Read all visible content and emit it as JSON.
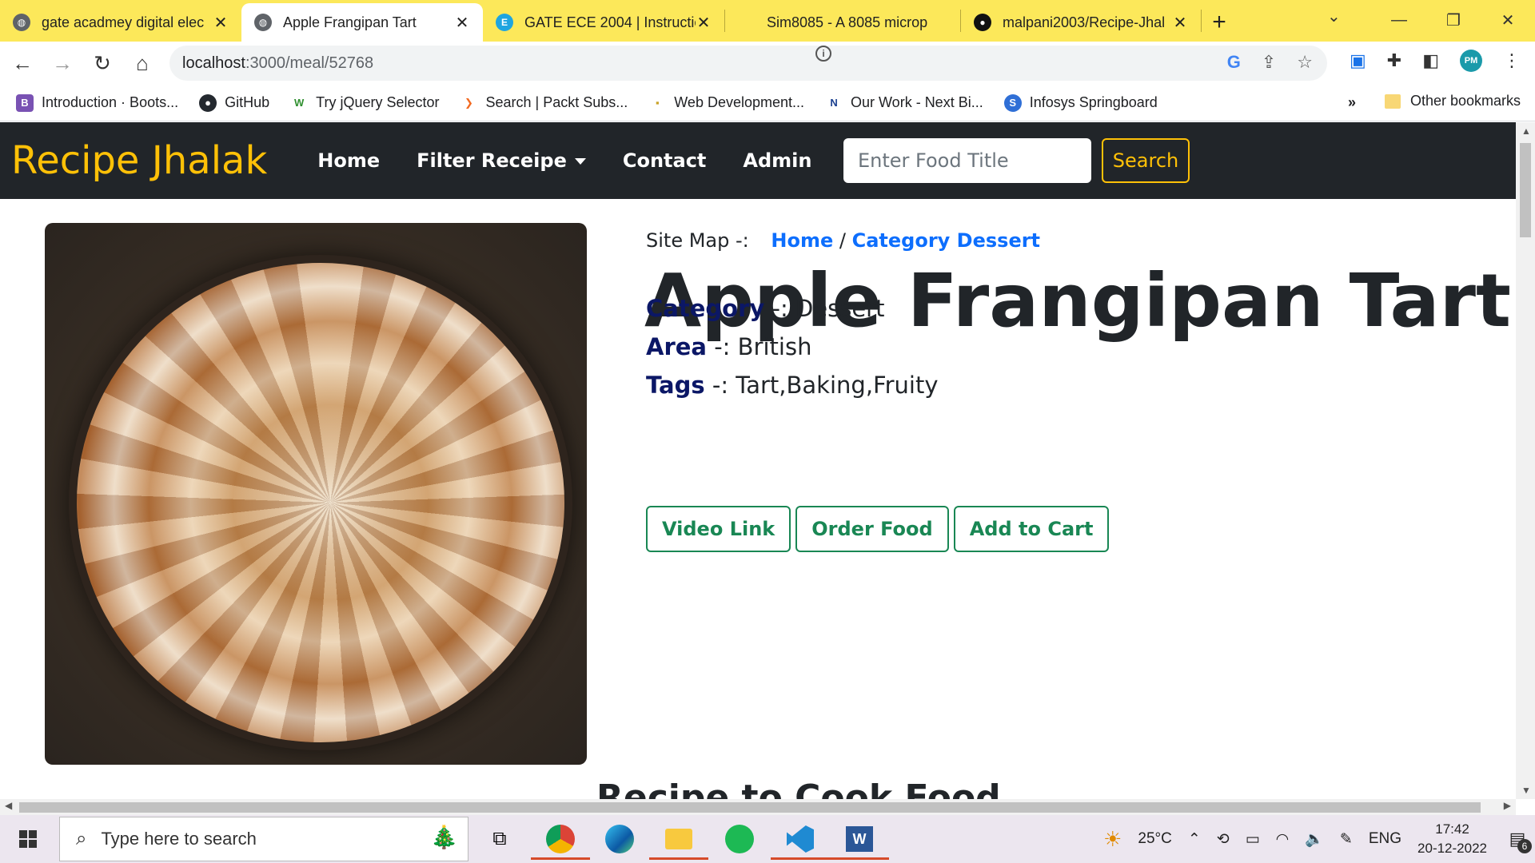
{
  "browser": {
    "tabs": [
      {
        "title": "gate acadmey digital elec",
        "active": false,
        "favicon": "globe-icon"
      },
      {
        "title": "Apple Frangipan Tart",
        "active": true,
        "favicon": "globe-icon"
      },
      {
        "title": "GATE ECE 2004 | Instructio",
        "active": false,
        "favicon": "e-icon"
      },
      {
        "title": "Sim8085 - A 8085 microp",
        "active": false,
        "favicon": "blank"
      },
      {
        "title": "malpani2003/Recipe-Jhal",
        "active": false,
        "favicon": "github-icon"
      }
    ],
    "address": {
      "host": "localhost",
      "path": ":3000/meal/52768"
    },
    "bookmarks": [
      {
        "label": "Introduction · Boots...",
        "icon": "bootstrap-icon",
        "color": "#7952b3"
      },
      {
        "label": "GitHub",
        "icon": "github-icon",
        "color": "#24292f"
      },
      {
        "label": "Try jQuery Selector",
        "icon": "w3-icon",
        "color": "#2f8f2f"
      },
      {
        "label": "Search | Packt Subs...",
        "icon": "packt-icon",
        "color": "#f26a21"
      },
      {
        "label": "Web Development...",
        "icon": "webdev-icon",
        "color": "#c9a227"
      },
      {
        "label": "Our Work - Next Bi...",
        "icon": "nextbig-icon",
        "color": "#1a3f8f"
      },
      {
        "label": "Infosys Springboard",
        "icon": "infosys-icon",
        "color": "#2f6fd6"
      }
    ],
    "bookmarks_more": "»",
    "other_bookmarks": "Other bookmarks"
  },
  "site": {
    "brand": "Recipe Jhalak",
    "nav": [
      "Home",
      "Filter Receipe",
      "Contact",
      "Admin"
    ],
    "search_placeholder": "Enter Food Title",
    "search_button": "Search"
  },
  "meal": {
    "sitemap_label": "Site Map -:",
    "crumb_home": "Home",
    "crumb_separator": "/",
    "crumb_category": "Category Dessert",
    "title": "Apple Frangipan Tart",
    "category_key": "Category",
    "category_value": " -: Dessert",
    "area_key": "Area",
    "area_value": " -: British",
    "tags_key": "Tags",
    "tags_value": " -: Tart,Baking,Fruity",
    "buttons": [
      "Video Link",
      "Order Food",
      "Add to Cart"
    ],
    "next_section_heading": "Recipe to Cook Food"
  },
  "taskbar": {
    "search_placeholder": "Type here to search",
    "weather": "25°C",
    "language": "ENG",
    "time": "17:42",
    "date": "20-12-2022",
    "notification_count": "6"
  }
}
